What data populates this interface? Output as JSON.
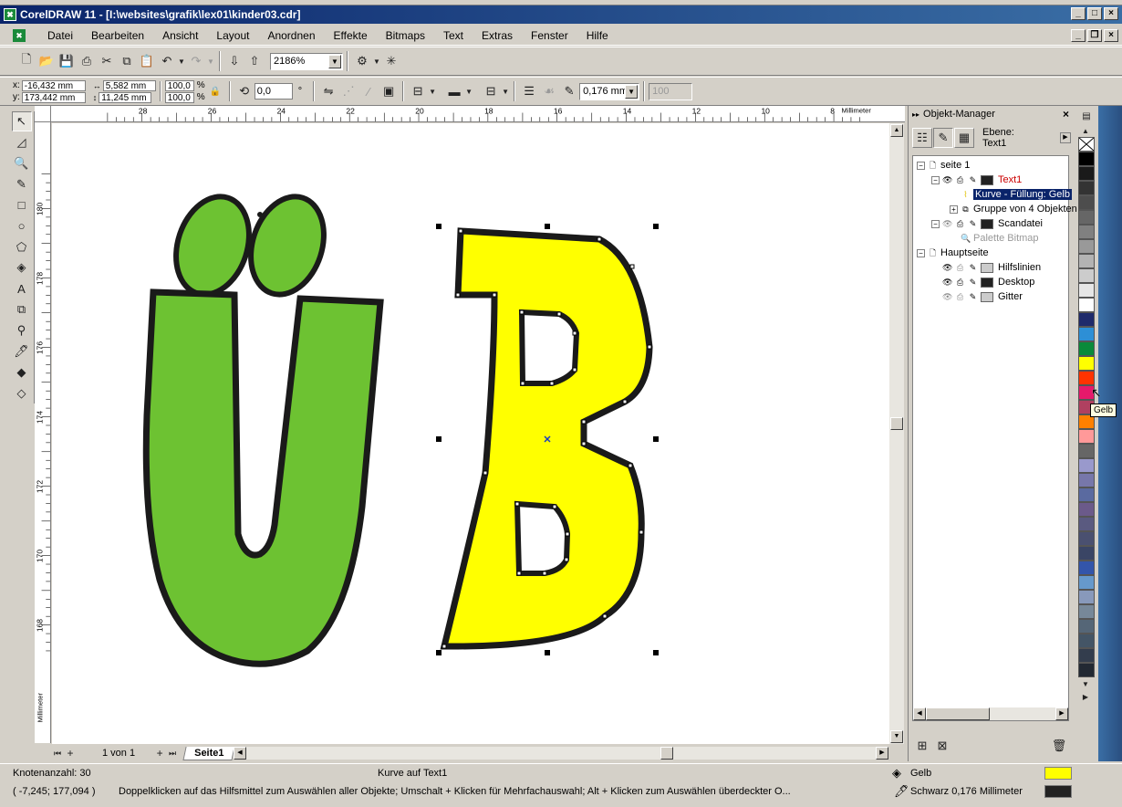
{
  "window": {
    "title": "CorelDRAW 11 - [I:\\websites\\grafik\\lex01\\kinder03.cdr]"
  },
  "menu": [
    "Datei",
    "Bearbeiten",
    "Ansicht",
    "Layout",
    "Anordnen",
    "Effekte",
    "Bitmaps",
    "Text",
    "Extras",
    "Fenster",
    "Hilfe"
  ],
  "toolbar": {
    "zoom": "2186%"
  },
  "propbar": {
    "x": "-16,432 mm",
    "y": "173,442 mm",
    "width": "5,582 mm",
    "height": "11,245 mm",
    "scale_x": "100,0",
    "scale_y": "100,0",
    "percent": "%",
    "rotation": "0,0",
    "degree": "°",
    "outline_width": "0,176 mm",
    "outline_scale": "100"
  },
  "rulers": {
    "h_ticks": [
      "28",
      "26",
      "24",
      "22",
      "20",
      "18",
      "16",
      "14",
      "12",
      "10",
      "8"
    ],
    "h_unit": "Millimeter",
    "v_ticks": [
      "180",
      "178",
      "176",
      "174",
      "172",
      "170",
      "168"
    ],
    "v_unit": "Millimeter"
  },
  "pages": {
    "counter": "1 von 1",
    "tab": "Seite1"
  },
  "status": {
    "nodes": "Knotenanzahl: 30",
    "object": "Kurve auf Text1",
    "coords": "( -7,245; 177,094 )",
    "hint": "Doppelklicken auf das Hilfsmittel zum Auswählen aller Objekte; Umschalt + Klicken für Mehrfachauswahl; Alt + Klicken zum Auswählen überdeckter O...",
    "fill_name": "Gelb",
    "outline": "Schwarz  0,176 Millimeter",
    "fill_color": "#ffff00",
    "outline_color": "#222222"
  },
  "docker": {
    "title": "Objekt-Manager",
    "layer_label": "Ebene:",
    "layer_value": "Text1",
    "tree": [
      "seite 1",
      "Text1",
      "Kurve - Füllung: Gelb",
      "Gruppe von 4 Objekten",
      "Scandatei",
      "Palette Bitmap",
      "Hauptseite",
      "Hilfslinien",
      "Desktop",
      "Gitter"
    ]
  },
  "tooltip": "Gelb",
  "palette_colors": [
    "#000000",
    "#1a1a1a",
    "#333333",
    "#4d4d4d",
    "#666666",
    "#808080",
    "#999999",
    "#b3b3b3",
    "#cccccc",
    "#e6e6e6",
    "#ffffff",
    "#1f2a6b",
    "#2d8fd6",
    "#0a8a3a",
    "#ffff00",
    "#ff3300",
    "#e6196b",
    "#b04060",
    "#ff8000",
    "#ff9999",
    "#666666",
    "#9999cc",
    "#7777aa",
    "#5a6aa0",
    "#6b5a8a",
    "#5a5a80",
    "#4a5070",
    "#3a4565",
    "#3355aa",
    "#6699cc",
    "#8899bb",
    "#778899",
    "#556677",
    "#445566",
    "#333d4d",
    "#222933"
  ],
  "colors": {
    "green": "#6dc232",
    "yellow": "#ffff00",
    "outline": "#1a1a1a"
  }
}
